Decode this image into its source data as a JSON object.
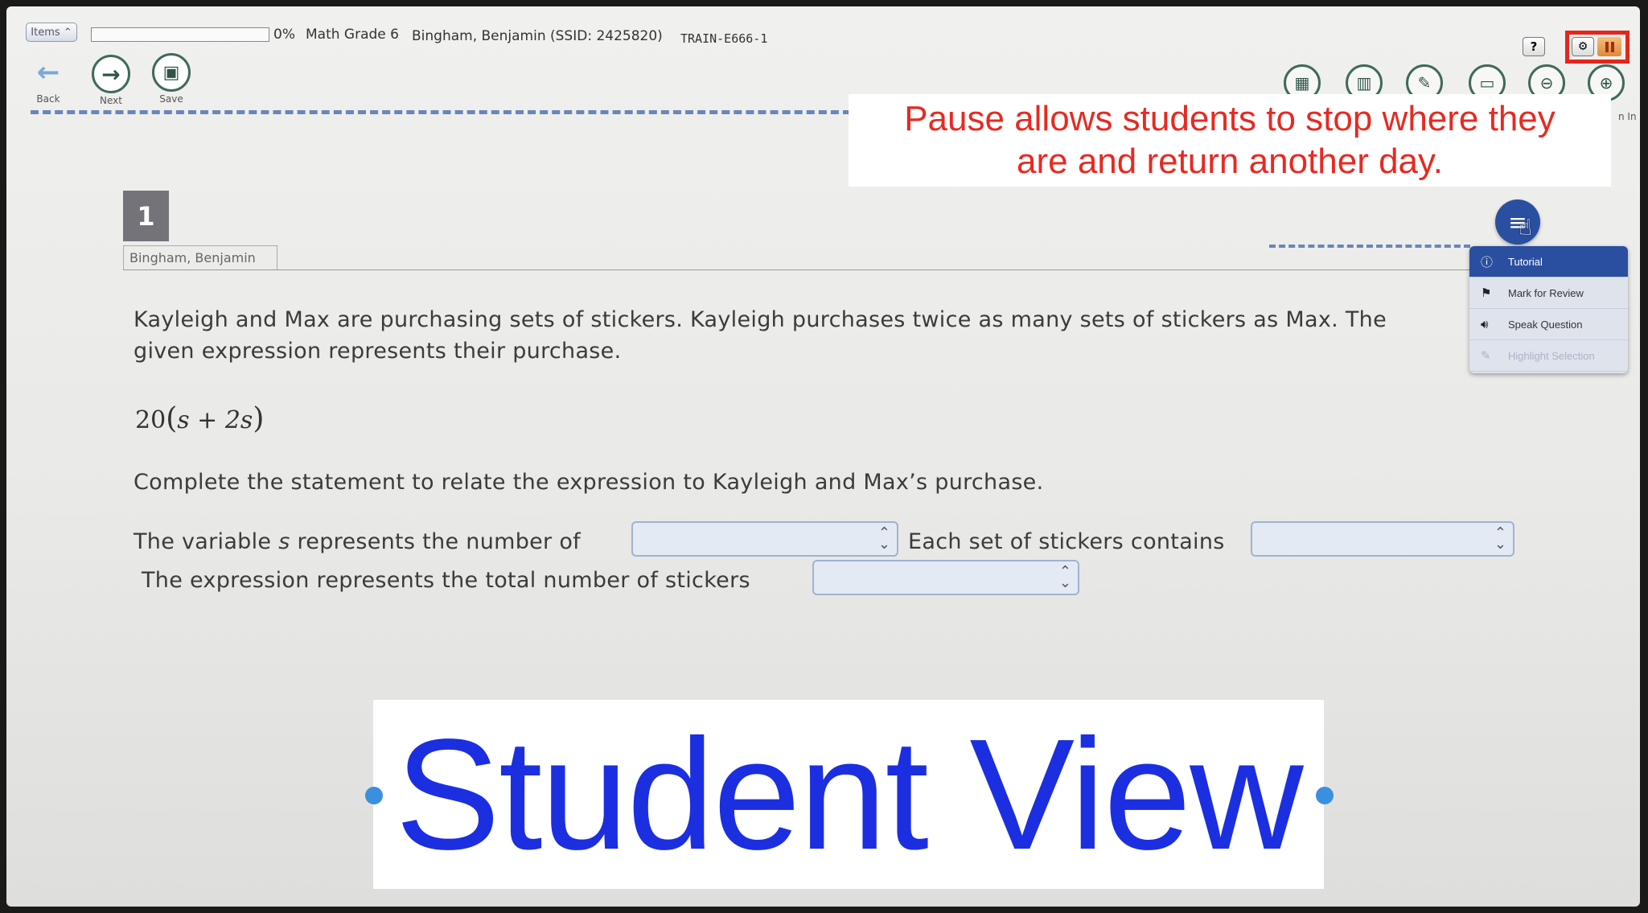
{
  "topbar": {
    "items_label": "Items",
    "progress_percent": 0,
    "progress_text": "0%",
    "test_name": "Math Grade 6",
    "student": "Bingham, Benjamin (SSID: 2425820)",
    "session_id": "TRAIN-E666-1",
    "help_label": "?",
    "settings_label": "⚙"
  },
  "nav": {
    "back_label": "Back",
    "next_label": "Next",
    "save_label": "Save"
  },
  "tools": {
    "zoom_in_label": "n In"
  },
  "annotation": {
    "line1": "Pause allows students to stop where they",
    "line2": "are and return another day.",
    "highlight_color": "#e5261c"
  },
  "question": {
    "number": "1",
    "student_tab": "Bingham, Benjamin",
    "text_line1": "Kayleigh and Max are purchasing sets of stickers. Kayleigh purchases twice as many sets of stickers as Max. The",
    "text_line2": "given expression represents their purchase.",
    "expression": "20",
    "expression_inner": "s + 2s",
    "instruction": "Complete the statement to relate the expression to Kayleigh and Max’s purchase.",
    "row1_prefix": "The variable",
    "row1_var": "s",
    "row1_suffix": "represents the number of",
    "row1_mid": "Each set of stickers contains",
    "row2_label": "The expression represents the total number of stickers"
  },
  "menu": {
    "items": [
      {
        "label": "Tutorial",
        "icon": "info-icon"
      },
      {
        "label": "Mark for Review",
        "icon": "flag-icon"
      },
      {
        "label": "Speak Question",
        "icon": "speaker-icon"
      },
      {
        "label": "Highlight Selection",
        "icon": "highlighter-icon"
      }
    ]
  },
  "overlay": {
    "title": "Student View",
    "color": "#1b2fe0"
  }
}
